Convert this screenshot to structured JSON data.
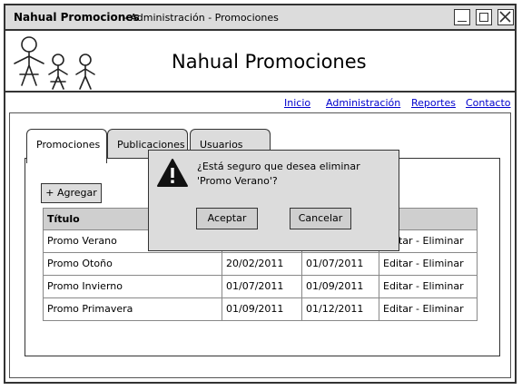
{
  "window": {
    "app_name": "Nahual Promociones",
    "subtitle": "- Administración - Promociones"
  },
  "header": {
    "title": "Nahual Promociones"
  },
  "nav": {
    "items": [
      "Inicio",
      "Administración",
      "Reportes",
      "Contacto"
    ]
  },
  "tabs": [
    "Promociones",
    "Publicaciones",
    "Usuarios"
  ],
  "toolbar": {
    "add_label": "+ Agregar"
  },
  "table": {
    "columns": [
      "Título",
      "",
      "",
      ""
    ],
    "rows": [
      [
        "Promo Verano",
        "",
        "",
        "Editar - Eliminar"
      ],
      [
        "Promo Otoño",
        "20/02/2011",
        "01/07/2011",
        "Editar - Eliminar"
      ],
      [
        "Promo Invierno",
        "01/07/2011",
        "01/09/2011",
        "Editar - Eliminar"
      ],
      [
        "Promo Primavera",
        "01/09/2011",
        "01/12/2011",
        "Editar - Eliminar"
      ]
    ]
  },
  "dialog": {
    "message": "¿Está seguro que desea eliminar 'Promo Verano'?",
    "accept_label": "Aceptar",
    "cancel_label": "Cancelar",
    "icon": "warning-icon"
  }
}
